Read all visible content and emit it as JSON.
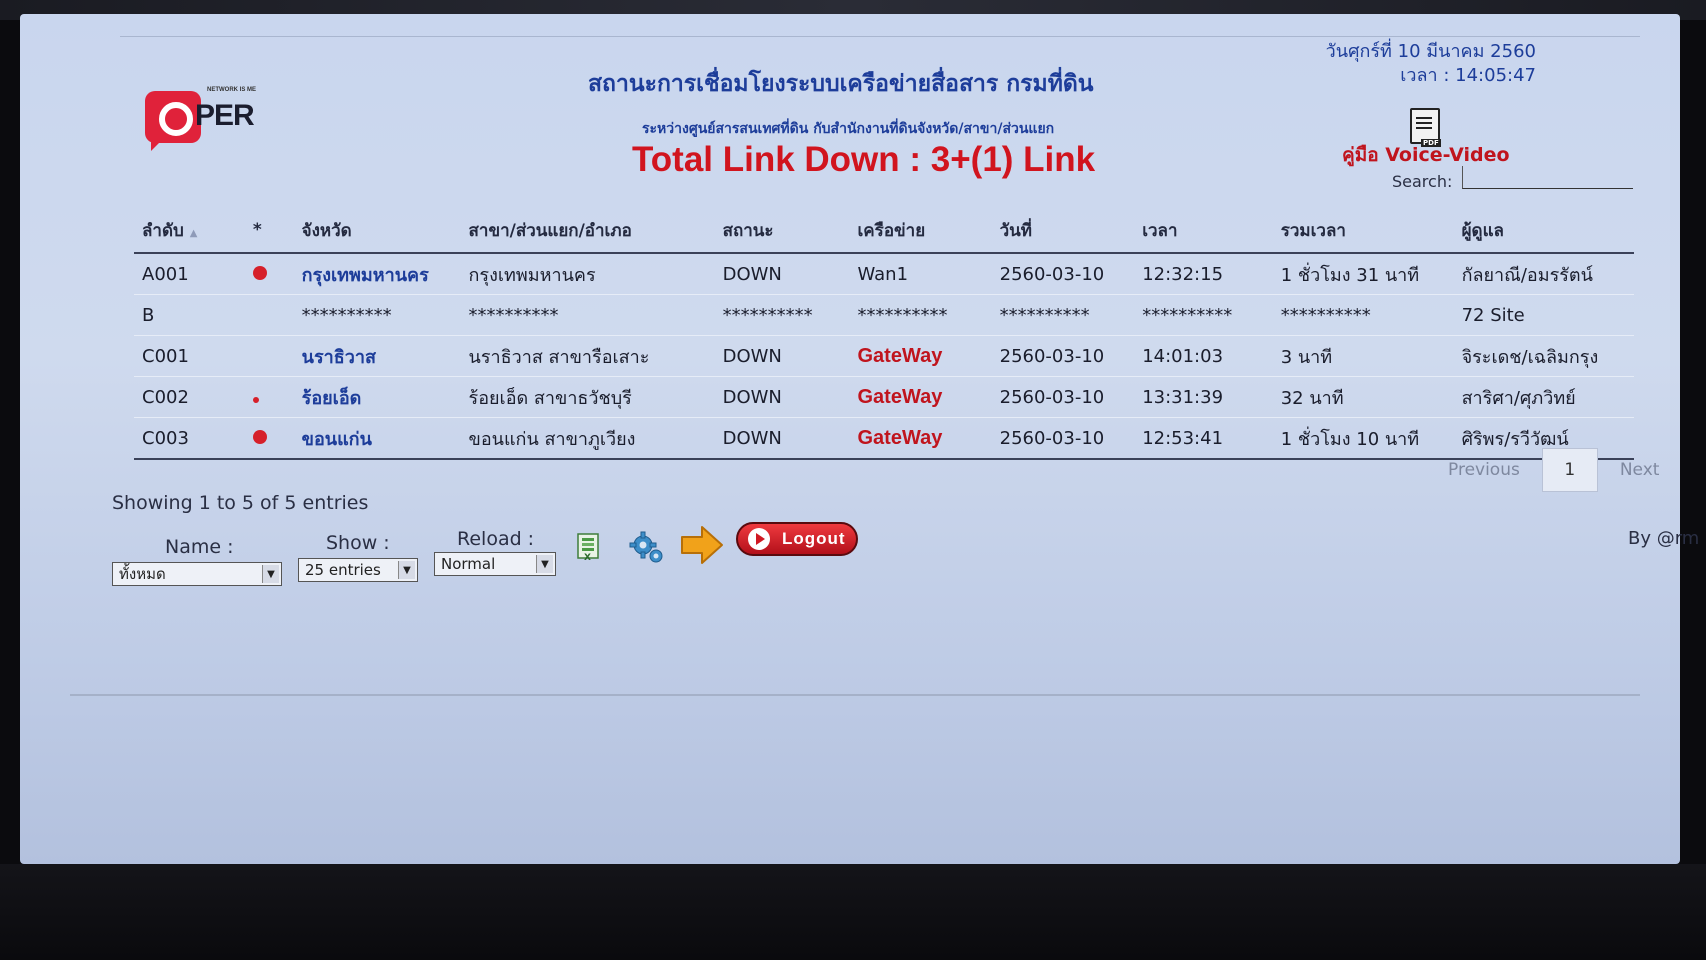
{
  "header": {
    "title": "สถานะการเชื่อมโยงระบบเครือข่ายสื่อสาร กรมที่ดิน",
    "subtitle": "ระหว่างศูนย์สารสนเทศที่ดิน กับสำนักงานที่ดินจังหวัด/สาขา/ส่วนแยก",
    "link_down": "Total Link Down : 3+(1) Link",
    "date": "วันศุกร์ที่ 10 มีนาคม 2560",
    "time": "เวลา : 14:05:47",
    "logo_text": "PER",
    "logo_small": "NETWORK IS ME"
  },
  "manual": {
    "label": "คู่มือ Voice-Video",
    "icon": "pdf-icon"
  },
  "search": {
    "label": "Search:",
    "value": ""
  },
  "table": {
    "columns": [
      "ลำดับ",
      "*",
      "จังหวัด",
      "สาขา/ส่วนแยก/อำเภอ",
      "สถานะ",
      "เครือข่าย",
      "วันที่",
      "เวลา",
      "รวมเวลา",
      "ผู้ดูแล"
    ],
    "rows": [
      {
        "id": "A001",
        "dot": "big",
        "province": "กรุงเทพมหานคร",
        "branch": "กรุงเทพมหานคร",
        "status": "DOWN",
        "network": "Wan1",
        "date": "2560-03-10",
        "time": "12:32:15",
        "duration": "1 ชั่วโมง 31 นาที",
        "owner": "กัลยาณี/อมรรัตน์"
      },
      {
        "id": "B",
        "dot": "",
        "province": "**********",
        "branch": "**********",
        "status": "**********",
        "network": "**********",
        "date": "**********",
        "time": "**********",
        "duration": "**********",
        "owner": "72 Site"
      },
      {
        "id": "C001",
        "dot": "",
        "province": "นราธิวาส",
        "branch": "นราธิวาส สาขารือเสาะ",
        "status": "DOWN",
        "network": "GateWay",
        "date": "2560-03-10",
        "time": "14:01:03",
        "duration": "3 นาที",
        "owner": "จิระเดช/เฉลิมกรุง"
      },
      {
        "id": "C002",
        "dot": "small",
        "province": "ร้อยเอ็ด",
        "branch": "ร้อยเอ็ด สาขาธวัชบุรี",
        "status": "DOWN",
        "network": "GateWay",
        "date": "2560-03-10",
        "time": "13:31:39",
        "duration": "32 นาที",
        "owner": "สาริศา/ศุภวิทย์"
      },
      {
        "id": "C003",
        "dot": "big",
        "province": "ขอนแก่น",
        "branch": "ขอนแก่น สาขาภูเวียง",
        "status": "DOWN",
        "network": "GateWay",
        "date": "2560-03-10",
        "time": "12:53:41",
        "duration": "1 ชั่วโมง 10 นาที",
        "owner": "ศิริพร/รวีวัฒน์"
      }
    ]
  },
  "pagination": {
    "previous": "Previous",
    "page": "1",
    "next": "Next"
  },
  "showing": "Showing 1 to 5 of 5 entries",
  "controls": {
    "name_label": "Name :",
    "name_value": "ทั้งหมด",
    "show_label": "Show :",
    "show_value": "25 entries",
    "reload_label": "Reload :",
    "reload_value": "Normal",
    "logout": "Logout"
  },
  "byline": "By @rm",
  "colors": {
    "title_blue": "#1d3d9a",
    "alert_red": "#d1141e",
    "screen_bg": "#c9d6ee"
  }
}
